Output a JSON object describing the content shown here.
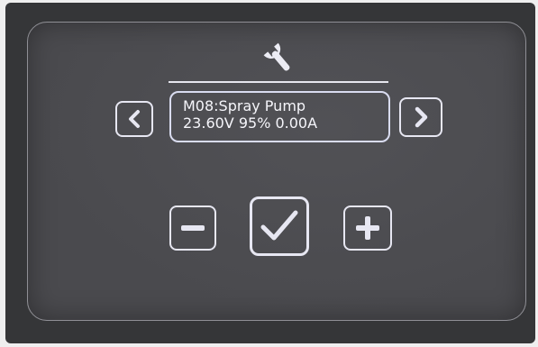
{
  "screen": {
    "header_icon": "wrench-icon",
    "module_line": "M08:Spray Pump",
    "status_line": "23.60V 95% 0.00A"
  },
  "controls": {
    "prev_icon": "chevron-left-icon",
    "next_icon": "chevron-right-icon",
    "decrease_icon": "minus-icon",
    "confirm_icon": "checkmark-icon",
    "increase_icon": "plus-icon"
  },
  "colors": {
    "foreground": "#e7e7f2",
    "screen_background": "#4a4a4e",
    "bezel": "#353638"
  }
}
